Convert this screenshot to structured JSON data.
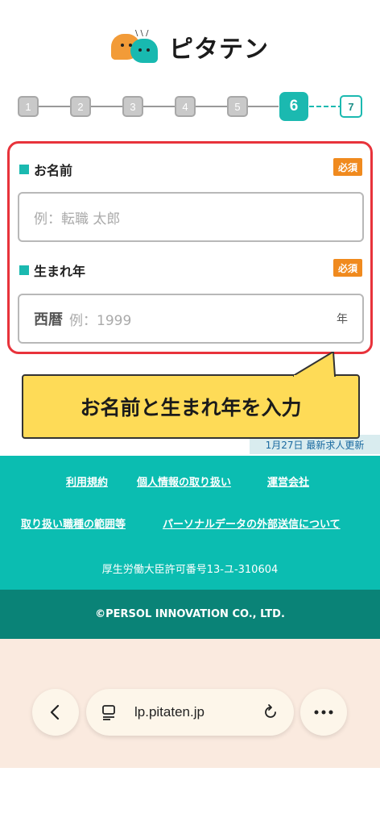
{
  "header": {
    "logo_text": "ピタテン"
  },
  "steps": {
    "items": [
      "1",
      "2",
      "3",
      "4",
      "5",
      "6",
      "7"
    ],
    "active": "6"
  },
  "form": {
    "name_label": "お名前",
    "name_required": "必須",
    "name_placeholder": "例：転職 太郎",
    "birth_label": "生まれ年",
    "birth_required": "必須",
    "birth_prefix": "西暦",
    "birth_placeholder": "例：1999",
    "birth_suffix": "年"
  },
  "callout": {
    "text": "お名前と生まれ年を入力"
  },
  "badge": {
    "text": "1月27日 最新求人更新"
  },
  "footer": {
    "links": [
      "利用規約",
      "個人情報の取り扱い",
      "運営会社",
      "取り扱い職種の範囲等",
      "パーソナルデータの外部送信について"
    ],
    "license": "厚生労働大臣許可番号13-ユ-310604",
    "copyright": "©PERSOL INNOVATION CO., LTD."
  },
  "browser": {
    "url": "lp.pitaten.jp",
    "back_icon": "chevron-left-icon",
    "reader_icon": "reader-icon",
    "reload_icon": "reload-icon",
    "more_icon": "more-icon"
  },
  "colors": {
    "teal": "#1bb9b0",
    "footer_teal": "#0bbdb1",
    "footer_dark": "#0a8377",
    "highlight_red": "#e8333b",
    "required_orange": "#f08a1e",
    "callout_yellow": "#fedb57"
  }
}
